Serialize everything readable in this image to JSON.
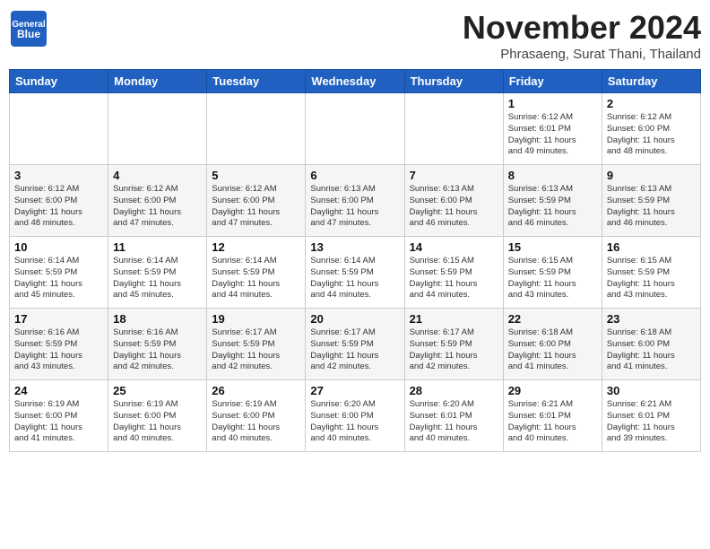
{
  "header": {
    "logo_general": "General",
    "logo_blue": "Blue",
    "month": "November 2024",
    "location": "Phrasaeng, Surat Thani, Thailand"
  },
  "days_of_week": [
    "Sunday",
    "Monday",
    "Tuesday",
    "Wednesday",
    "Thursday",
    "Friday",
    "Saturday"
  ],
  "weeks": [
    [
      {
        "day": "",
        "info": ""
      },
      {
        "day": "",
        "info": ""
      },
      {
        "day": "",
        "info": ""
      },
      {
        "day": "",
        "info": ""
      },
      {
        "day": "",
        "info": ""
      },
      {
        "day": "1",
        "info": "Sunrise: 6:12 AM\nSunset: 6:01 PM\nDaylight: 11 hours\nand 49 minutes."
      },
      {
        "day": "2",
        "info": "Sunrise: 6:12 AM\nSunset: 6:00 PM\nDaylight: 11 hours\nand 48 minutes."
      }
    ],
    [
      {
        "day": "3",
        "info": "Sunrise: 6:12 AM\nSunset: 6:00 PM\nDaylight: 11 hours\nand 48 minutes."
      },
      {
        "day": "4",
        "info": "Sunrise: 6:12 AM\nSunset: 6:00 PM\nDaylight: 11 hours\nand 47 minutes."
      },
      {
        "day": "5",
        "info": "Sunrise: 6:12 AM\nSunset: 6:00 PM\nDaylight: 11 hours\nand 47 minutes."
      },
      {
        "day": "6",
        "info": "Sunrise: 6:13 AM\nSunset: 6:00 PM\nDaylight: 11 hours\nand 47 minutes."
      },
      {
        "day": "7",
        "info": "Sunrise: 6:13 AM\nSunset: 6:00 PM\nDaylight: 11 hours\nand 46 minutes."
      },
      {
        "day": "8",
        "info": "Sunrise: 6:13 AM\nSunset: 5:59 PM\nDaylight: 11 hours\nand 46 minutes."
      },
      {
        "day": "9",
        "info": "Sunrise: 6:13 AM\nSunset: 5:59 PM\nDaylight: 11 hours\nand 46 minutes."
      }
    ],
    [
      {
        "day": "10",
        "info": "Sunrise: 6:14 AM\nSunset: 5:59 PM\nDaylight: 11 hours\nand 45 minutes."
      },
      {
        "day": "11",
        "info": "Sunrise: 6:14 AM\nSunset: 5:59 PM\nDaylight: 11 hours\nand 45 minutes."
      },
      {
        "day": "12",
        "info": "Sunrise: 6:14 AM\nSunset: 5:59 PM\nDaylight: 11 hours\nand 44 minutes."
      },
      {
        "day": "13",
        "info": "Sunrise: 6:14 AM\nSunset: 5:59 PM\nDaylight: 11 hours\nand 44 minutes."
      },
      {
        "day": "14",
        "info": "Sunrise: 6:15 AM\nSunset: 5:59 PM\nDaylight: 11 hours\nand 44 minutes."
      },
      {
        "day": "15",
        "info": "Sunrise: 6:15 AM\nSunset: 5:59 PM\nDaylight: 11 hours\nand 43 minutes."
      },
      {
        "day": "16",
        "info": "Sunrise: 6:15 AM\nSunset: 5:59 PM\nDaylight: 11 hours\nand 43 minutes."
      }
    ],
    [
      {
        "day": "17",
        "info": "Sunrise: 6:16 AM\nSunset: 5:59 PM\nDaylight: 11 hours\nand 43 minutes."
      },
      {
        "day": "18",
        "info": "Sunrise: 6:16 AM\nSunset: 5:59 PM\nDaylight: 11 hours\nand 42 minutes."
      },
      {
        "day": "19",
        "info": "Sunrise: 6:17 AM\nSunset: 5:59 PM\nDaylight: 11 hours\nand 42 minutes."
      },
      {
        "day": "20",
        "info": "Sunrise: 6:17 AM\nSunset: 5:59 PM\nDaylight: 11 hours\nand 42 minutes."
      },
      {
        "day": "21",
        "info": "Sunrise: 6:17 AM\nSunset: 5:59 PM\nDaylight: 11 hours\nand 42 minutes."
      },
      {
        "day": "22",
        "info": "Sunrise: 6:18 AM\nSunset: 6:00 PM\nDaylight: 11 hours\nand 41 minutes."
      },
      {
        "day": "23",
        "info": "Sunrise: 6:18 AM\nSunset: 6:00 PM\nDaylight: 11 hours\nand 41 minutes."
      }
    ],
    [
      {
        "day": "24",
        "info": "Sunrise: 6:19 AM\nSunset: 6:00 PM\nDaylight: 11 hours\nand 41 minutes."
      },
      {
        "day": "25",
        "info": "Sunrise: 6:19 AM\nSunset: 6:00 PM\nDaylight: 11 hours\nand 40 minutes."
      },
      {
        "day": "26",
        "info": "Sunrise: 6:19 AM\nSunset: 6:00 PM\nDaylight: 11 hours\nand 40 minutes."
      },
      {
        "day": "27",
        "info": "Sunrise: 6:20 AM\nSunset: 6:00 PM\nDaylight: 11 hours\nand 40 minutes."
      },
      {
        "day": "28",
        "info": "Sunrise: 6:20 AM\nSunset: 6:01 PM\nDaylight: 11 hours\nand 40 minutes."
      },
      {
        "day": "29",
        "info": "Sunrise: 6:21 AM\nSunset: 6:01 PM\nDaylight: 11 hours\nand 40 minutes."
      },
      {
        "day": "30",
        "info": "Sunrise: 6:21 AM\nSunset: 6:01 PM\nDaylight: 11 hours\nand 39 minutes."
      }
    ]
  ]
}
